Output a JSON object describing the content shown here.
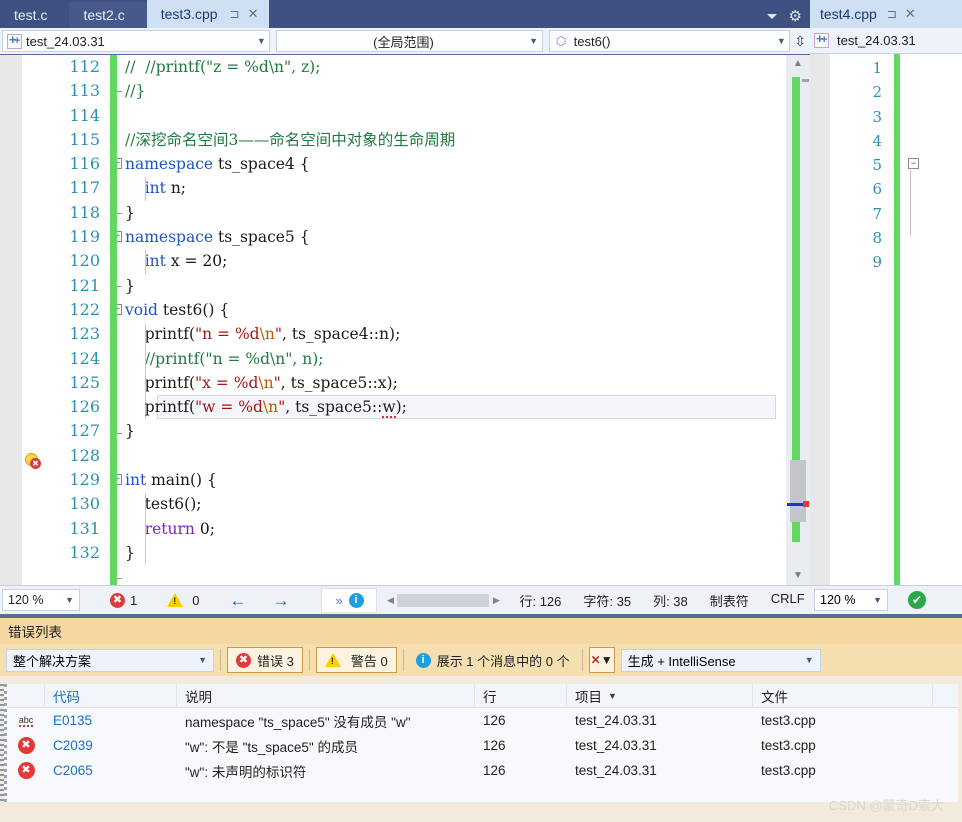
{
  "window": {
    "tabs": [
      {
        "label": "test.c",
        "active": false
      },
      {
        "label": "test2.c",
        "active": false
      },
      {
        "label": "test3.cpp",
        "active": true
      }
    ],
    "tab_pin_icon": "pin-icon",
    "tab_close_icon": "close-icon",
    "strip_overflow_icon": "chevron-down-icon",
    "strip_settings_icon": "gear-icon"
  },
  "navbar": {
    "project": "test_24.03.31",
    "project_icon": "project-cpp-icon",
    "scope": "(全局范围)",
    "member": "test6()",
    "member_icon": "method-icon",
    "split_icon": "split-window-icon",
    "dropdown_icon": "chevron-down-icon"
  },
  "editor": {
    "lines": [
      {
        "num": "112",
        "fold": "",
        "text": "//  //printf(\"z = %d\\n\", z);"
      },
      {
        "num": "113",
        "fold": "",
        "text": "//}"
      },
      {
        "num": "114",
        "fold": "",
        "text": ""
      },
      {
        "num": "115",
        "fold": "",
        "text": "//深挖命名空间3——命名空间中对象的生命周期"
      },
      {
        "num": "116",
        "fold": "-",
        "text": "namespace ts_space4 {"
      },
      {
        "num": "117",
        "fold": "",
        "text": "    int n;"
      },
      {
        "num": "118",
        "fold": "",
        "text": "}"
      },
      {
        "num": "119",
        "fold": "-",
        "text": "namespace ts_space5 {"
      },
      {
        "num": "120",
        "fold": "",
        "text": "    int x = 20;"
      },
      {
        "num": "121",
        "fold": "",
        "text": "}"
      },
      {
        "num": "122",
        "fold": "-",
        "text": "void test6() {"
      },
      {
        "num": "123",
        "fold": "",
        "text": "    printf(\"n = %d\\n\", ts_space4::n);"
      },
      {
        "num": "124",
        "fold": "",
        "text": "    //printf(\"n = %d\\n\", n);"
      },
      {
        "num": "125",
        "fold": "",
        "text": "    printf(\"x = %d\\n\", ts_space5::x);"
      },
      {
        "num": "126",
        "fold": "",
        "text": "    printf(\"w = %d\\n\", ts_space5::w);"
      },
      {
        "num": "127",
        "fold": "",
        "text": "}"
      },
      {
        "num": "128",
        "fold": "",
        "text": ""
      },
      {
        "num": "129",
        "fold": "-",
        "text": "int main() {"
      },
      {
        "num": "130",
        "fold": "",
        "text": "    test6();"
      },
      {
        "num": "131",
        "fold": "",
        "text": "    return 0;"
      },
      {
        "num": "132",
        "fold": "",
        "text": "}"
      }
    ],
    "current_line": "126",
    "bulb_icon": "lightbulb-error-icon"
  },
  "statusbar": {
    "zoom": "120 %",
    "error_count": "1",
    "warning_count": "0",
    "back_icon": "arrow-left-icon",
    "forward_icon": "arrow-right-icon",
    "chevrons_icon": "double-chevron-icon",
    "info_icon": "info-icon",
    "line_label": "行: 126",
    "char_label": "字符: 35",
    "col_label": "列: 38",
    "tab_label": "制表符",
    "eol_label": "CRLF"
  },
  "right_panel": {
    "tab_label": "test4.cpp",
    "pin_icon": "pin-icon",
    "close_icon": "close-icon",
    "project": "test_24.03.31",
    "project_icon": "project-cpp-icon",
    "line_numbers": [
      "1",
      "2",
      "3",
      "4",
      "5",
      "6",
      "7",
      "8",
      "9"
    ],
    "zoom": "120 %",
    "ok_icon": "check-circle-icon"
  },
  "error_list": {
    "title": "错误列表",
    "scope": "整个解决方案",
    "errors_button": "错误 3",
    "warnings_button": "警告 0",
    "messages_button": "展示 1 个消息中的 0 个",
    "filter_icon": "clear-filter-icon",
    "build_filter": "生成 + IntelliSense",
    "columns": [
      "",
      "",
      "代码",
      "说明",
      "行",
      "项目",
      "文件"
    ],
    "rows": [
      {
        "icon": "intellisense-squiggle-icon",
        "code": "E0135",
        "description": "namespace \"ts_space5\" 没有成员 \"w\"",
        "line": "126",
        "project": "test_24.03.31",
        "file": "test3.cpp"
      },
      {
        "icon": "error-icon",
        "code": "C2039",
        "description": "\"w\": 不是 \"ts_space5\" 的成员",
        "line": "126",
        "project": "test_24.03.31",
        "file": "test3.cpp"
      },
      {
        "icon": "error-icon",
        "code": "C2065",
        "description": "\"w\": 未声明的标识符",
        "line": "126",
        "project": "test_24.03.31",
        "file": "test3.cpp"
      }
    ]
  },
  "watermark": "CSDN @蒙奇D索大",
  "colors": {
    "accent_blue": "#3e5180",
    "active_tab": "#cfe0f4",
    "change_bar_green": "#62d862",
    "error_red": "#e03a3a",
    "warning_yellow": "#ffcc00",
    "panel_amber": "#f5d7a1"
  }
}
